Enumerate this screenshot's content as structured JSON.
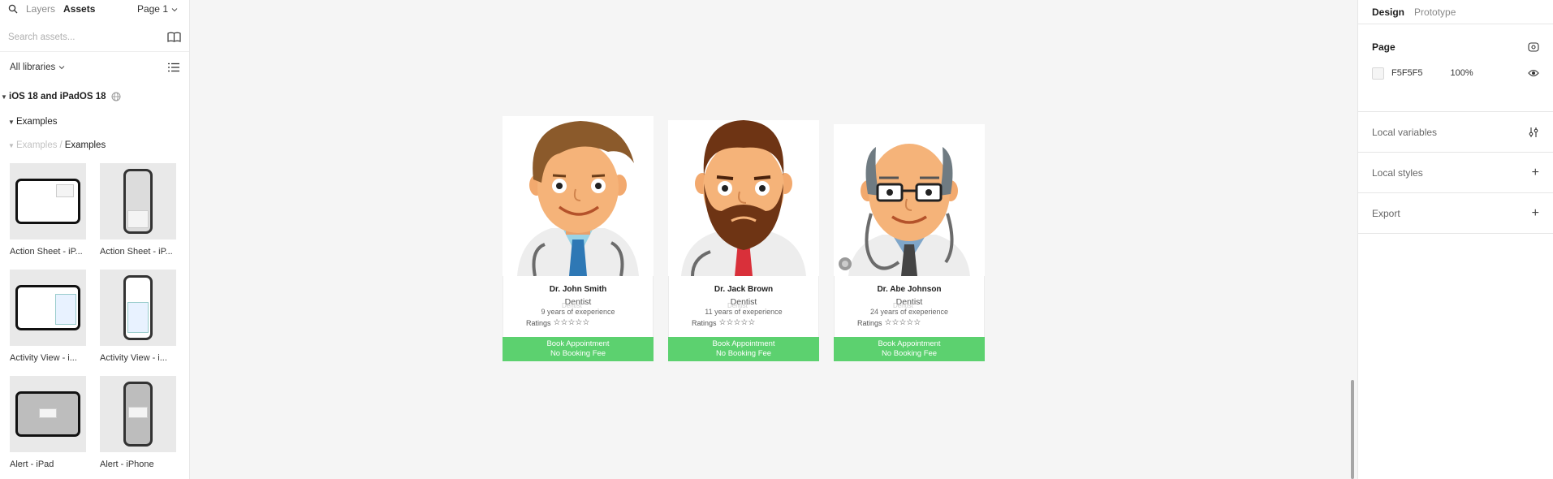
{
  "left_panel": {
    "tabs": [
      "Layers",
      "Assets"
    ],
    "page_selector": "Page 1",
    "search_placeholder": "Search assets...",
    "libraries_filter": "All libraries",
    "library_name": "iOS 18 and iPadOS 18",
    "section": "Examples",
    "breadcrumb_parent": "Examples",
    "breadcrumb_current": "Examples",
    "assets": [
      {
        "label": "Action Sheet - iP..."
      },
      {
        "label": "Action Sheet - iP..."
      },
      {
        "label": "Activity View - i..."
      },
      {
        "label": "Activity View - i..."
      },
      {
        "label": "Alert - iPad"
      },
      {
        "label": "Alert - iPhone"
      }
    ]
  },
  "canvas": {
    "doctors": [
      {
        "name": "Dr. John Smith",
        "specialty": "Dentist",
        "ghost": "Dentist",
        "experience": "9 years of exeperience",
        "ratings_label": "Ratings",
        "stars": "☆☆☆☆☆",
        "cta_line1": "Book Appointment",
        "cta_line2": "No Booking Fee"
      },
      {
        "name": "Dr. Jack Brown",
        "specialty": "Dentist",
        "ghost": "Dentist",
        "experience": "11 years of exeperience",
        "ratings_label": "Ratings",
        "stars": "☆☆☆☆☆",
        "cta_line1": "Book Appointment",
        "cta_line2": "No Booking Fee"
      },
      {
        "name": "Dr. Abe Johnson",
        "specialty": "Dentist",
        "ghost": "Dentist",
        "experience": "24 years of exeperience",
        "ratings_label": "Ratings",
        "stars": "☆☆☆☆☆",
        "cta_line1": "Book Appointment",
        "cta_line2": "No Booking Fee"
      }
    ],
    "button_color": "#5CD16F",
    "background": "#F5F5F5"
  },
  "right_panel": {
    "tabs": [
      "Design",
      "Prototype"
    ],
    "page_title": "Page",
    "page_color": "F5F5F5",
    "page_opacity": "100%",
    "local_variables": "Local variables",
    "local_styles": "Local styles",
    "export": "Export"
  }
}
